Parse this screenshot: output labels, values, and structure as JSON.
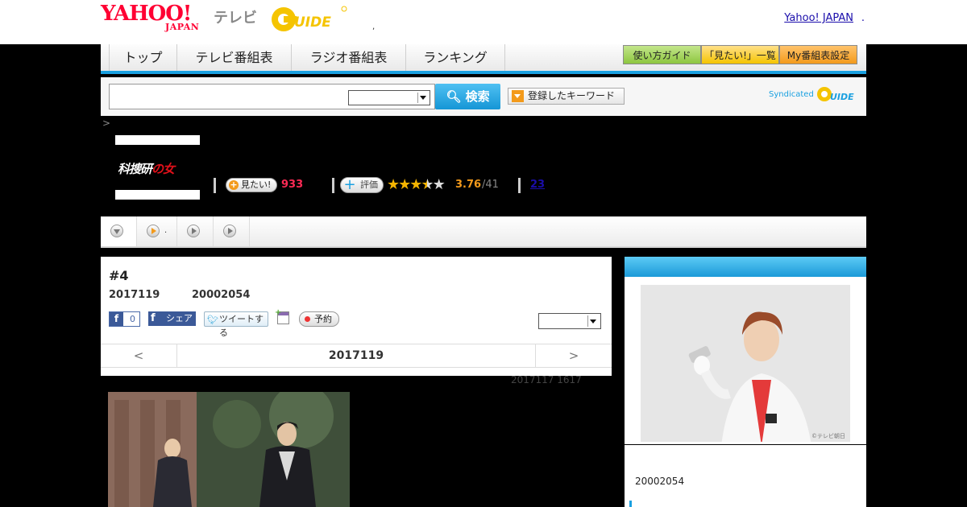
{
  "header": {
    "yahoo_logo": "YAHOO!",
    "japan_logo": "JAPAN",
    "tv_label": "テレビ",
    "gguide_logo": "G-GUIDE",
    "separator": ",",
    "yj_link": "Yahoo! JAPAN",
    "yj_dot": "."
  },
  "nav": {
    "items": [
      "トップ",
      "テレビ番組表",
      "ラジオ番組表",
      "ランキング"
    ],
    "right_buttons": [
      "使い方ガイド",
      "「見たい!」一覧",
      "My番組表設定"
    ]
  },
  "search": {
    "input_value": "",
    "select_value": "",
    "button_label": "検索",
    "keyword_button": "登録したキーワード",
    "syndicated": "Syndicated"
  },
  "breadcrumb": ">",
  "program": {
    "thumb_title_a": "科捜研",
    "thumb_title_b": "の女",
    "mitai_label": "見たい!",
    "mitai_count": "933",
    "eval_label": "評価",
    "rating": "3.76",
    "rating_count": "/41",
    "rating_fraction": 0.752,
    "review_count": "23"
  },
  "tabs": {
    "tab2_text": "."
  },
  "episode": {
    "title": "#4",
    "date": "2017119",
    "time": "20002054",
    "fb_like_count": "0",
    "fb_share_label": "シェア",
    "tweet_label": "ツイートする",
    "reserve_label": "予約",
    "select_value": "",
    "pager_prev": "<",
    "pager_current": "2017119",
    "pager_next": ">",
    "updated": "2017117  1617"
  },
  "right_column": {
    "copyright": "©テレビ朝日",
    "time": "20002054"
  },
  "colors": {
    "accent_blue": "#1aa0e0",
    "brand_red": "#ff0033",
    "count_pink": "#ff2a55",
    "rating_orange": "#f39a1b"
  }
}
